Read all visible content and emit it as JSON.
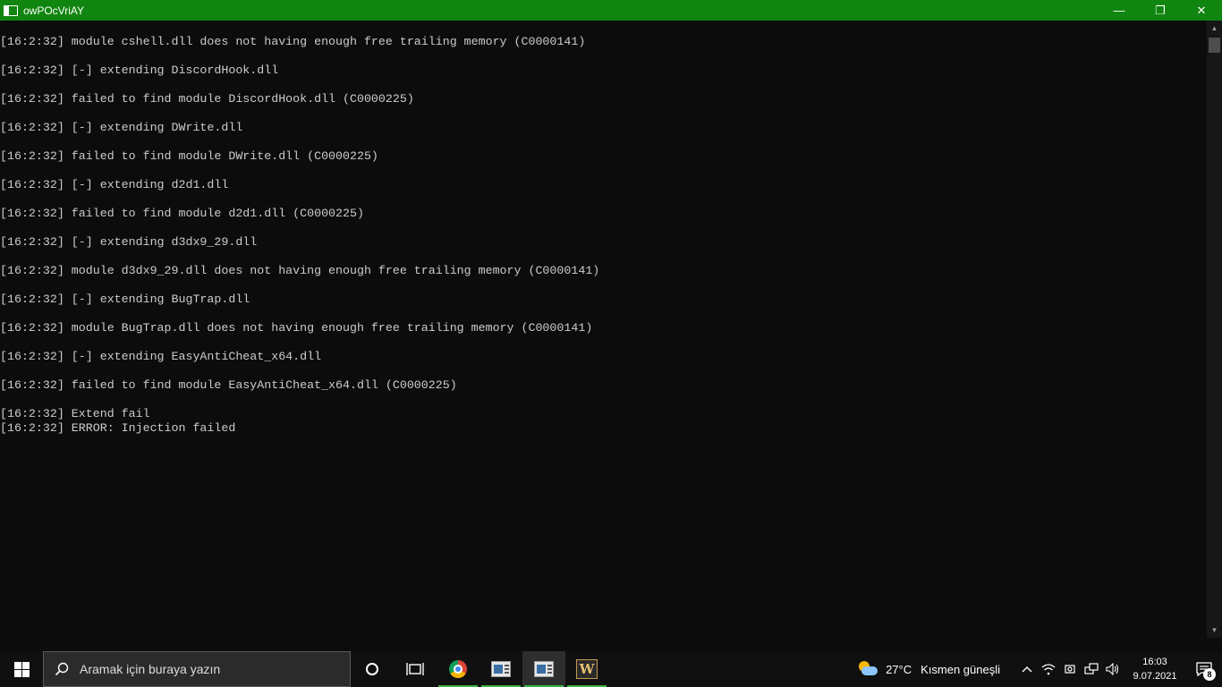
{
  "window": {
    "title": "owPOcVriAY",
    "controls": {
      "minimize": "—",
      "restore": "❐",
      "close": "✕"
    }
  },
  "console": {
    "lines": [
      "[16:2:32] module cshell.dll does not having enough free trailing memory (C0000141)",
      "",
      "[16:2:32] [-] extending DiscordHook.dll",
      "",
      "[16:2:32] failed to find module DiscordHook.dll (C0000225)",
      "",
      "[16:2:32] [-] extending DWrite.dll",
      "",
      "[16:2:32] failed to find module DWrite.dll (C0000225)",
      "",
      "[16:2:32] [-] extending d2d1.dll",
      "",
      "[16:2:32] failed to find module d2d1.dll (C0000225)",
      "",
      "[16:2:32] [-] extending d3dx9_29.dll",
      "",
      "[16:2:32] module d3dx9_29.dll does not having enough free trailing memory (C0000141)",
      "",
      "[16:2:32] [-] extending BugTrap.dll",
      "",
      "[16:2:32] module BugTrap.dll does not having enough free trailing memory (C0000141)",
      "",
      "[16:2:32] [-] extending EasyAntiCheat_x64.dll",
      "",
      "[16:2:32] failed to find module EasyAntiCheat_x64.dll (C0000225)",
      "",
      "[16:2:32] Extend fail",
      "[16:2:32] ERROR: Injection failed"
    ]
  },
  "taskbar": {
    "search_placeholder": "Aramak için buraya yazın",
    "weather": {
      "temp": "27°C",
      "desc": "Kısmen güneşli"
    },
    "clock": {
      "time": "16:03",
      "date": "9.07.2021"
    },
    "notification_count": "8",
    "icons": [
      "windows-icon",
      "search-icon",
      "cortana-icon",
      "task-view-icon",
      "chrome-icon",
      "terminal-icon",
      "terminal-active-icon",
      "w-app-icon"
    ]
  },
  "colors": {
    "titlebar": "#10850f",
    "console_bg": "#0c0c0c",
    "console_text": "#cccccc",
    "taskbar": "#101010"
  }
}
